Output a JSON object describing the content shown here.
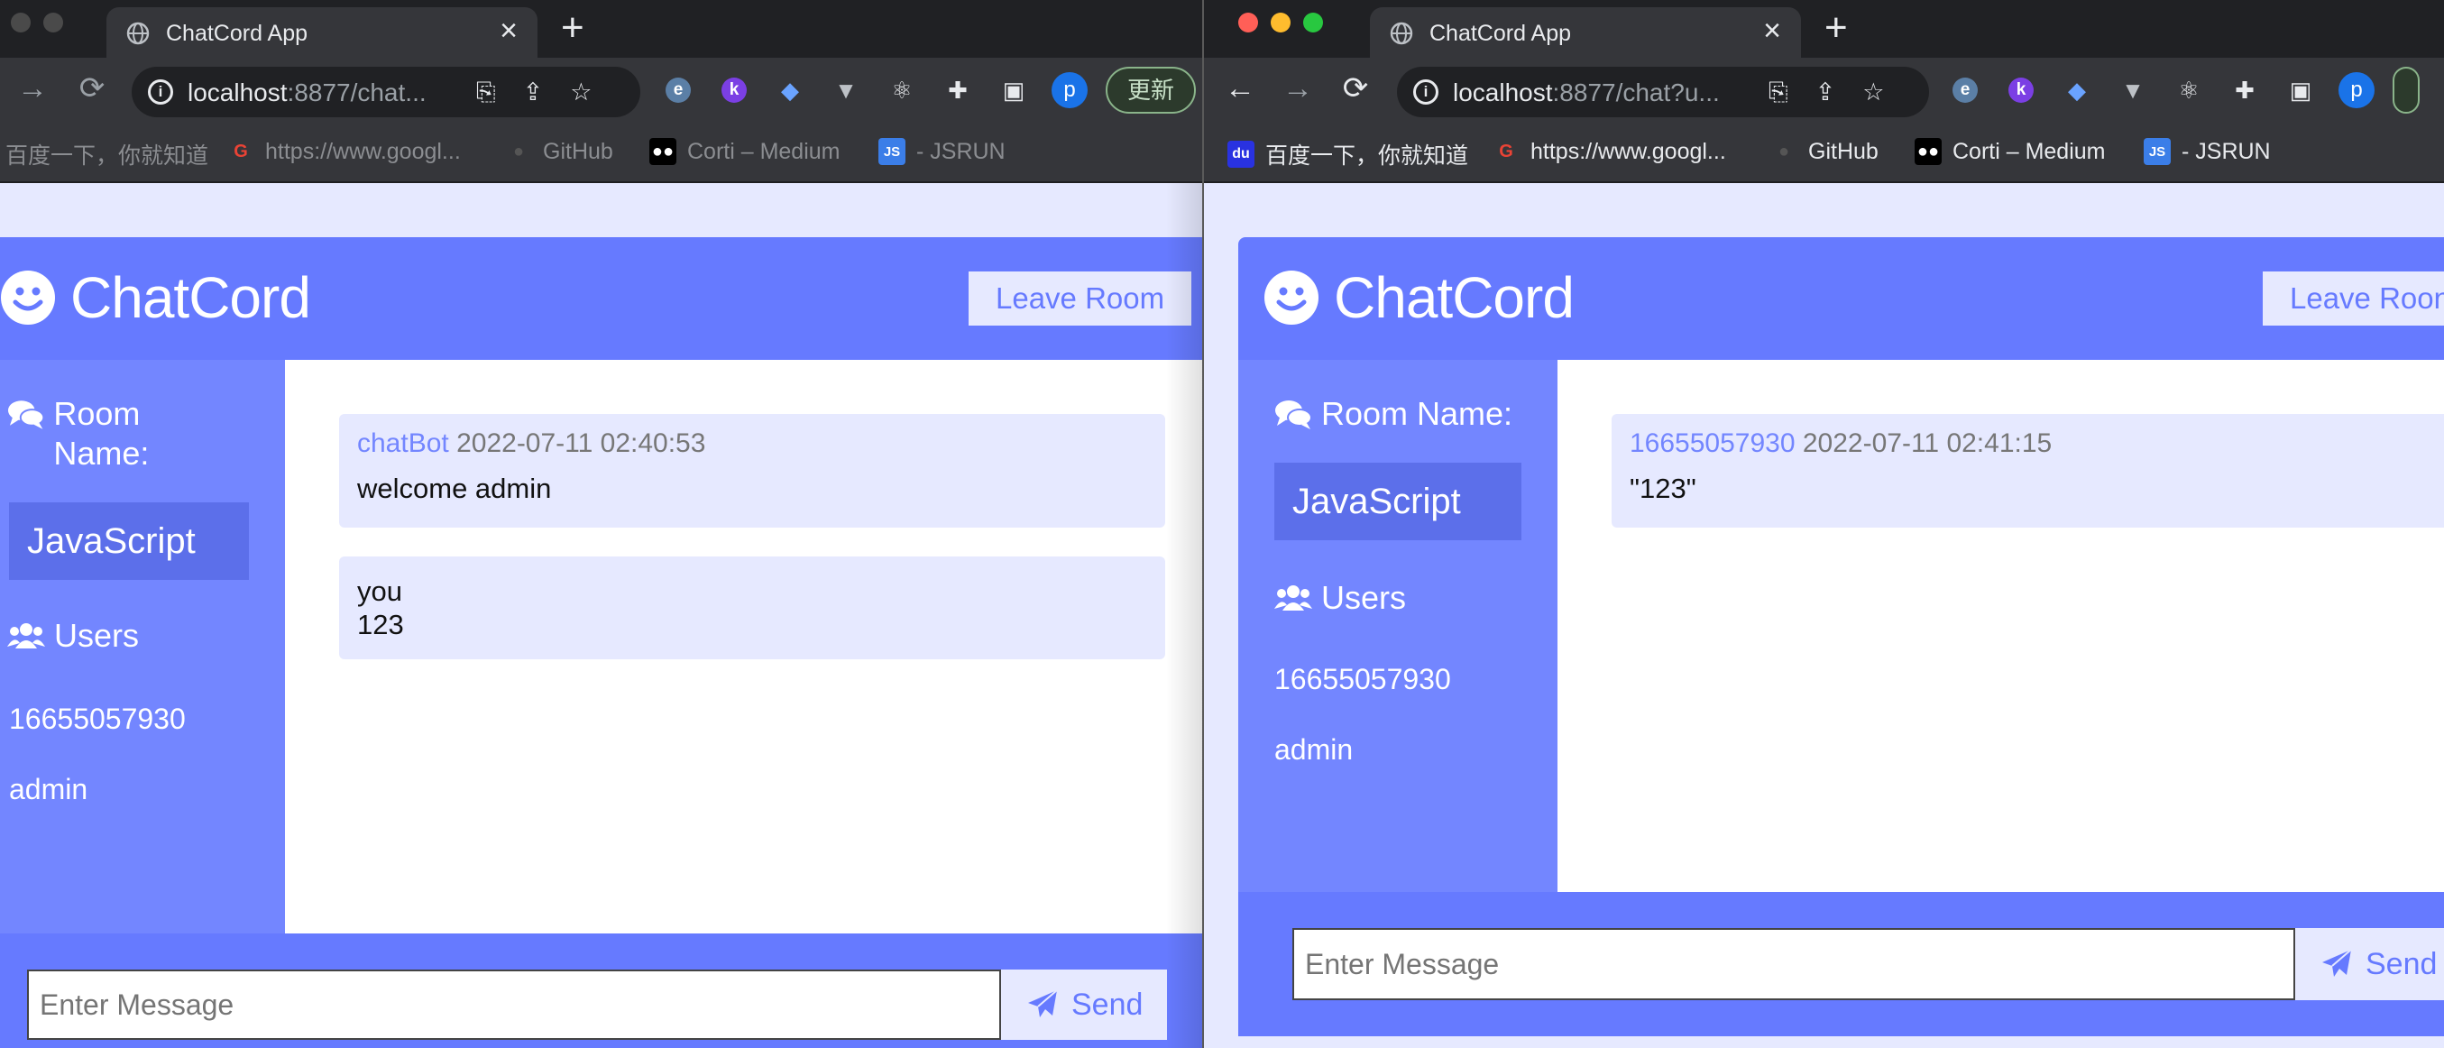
{
  "colors": {
    "brand": "#667aff",
    "sidebar": "#7386ff",
    "light": "#e6e9ff",
    "room_box": "#5c6fea"
  },
  "left": {
    "tab_title": "ChatCord App",
    "url_host": "localhost",
    "url_rest": ":8877/chat...",
    "update_label": "更新",
    "avatar_letter": "p",
    "bookmarks": [
      "百度一下，你就知道",
      "https://www.googl...",
      "GitHub",
      "Corti – Medium",
      "- JSRUN"
    ],
    "brand": "ChatCord",
    "leave_label": "Leave Room",
    "room_name_label": "Room Name:",
    "room_name": "JavaScript",
    "users_label": "Users",
    "users": [
      "16655057930",
      "admin"
    ],
    "messages": [
      {
        "user": "chatBot",
        "time": "2022-07-11 02:40:53",
        "text": "welcome admin"
      },
      {
        "user": "you",
        "time": "",
        "text": "123"
      }
    ],
    "input_placeholder": "Enter Message",
    "send_label": "Send"
  },
  "right": {
    "tab_title": "ChatCord App",
    "url_host": "localhost",
    "url_rest": ":8877/chat?u...",
    "avatar_letter": "p",
    "bookmarks": [
      "百度一下，你就知道",
      "https://www.googl...",
      "GitHub",
      "Corti – Medium",
      "- JSRUN"
    ],
    "brand": "ChatCord",
    "leave_label": "Leave Roon",
    "room_name_label": "Room Name:",
    "room_name": "JavaScript",
    "users_label": "Users",
    "users": [
      "16655057930",
      "admin"
    ],
    "messages": [
      {
        "user": "16655057930",
        "time": "2022-07-11 02:41:15",
        "text": "\"123\""
      }
    ],
    "input_placeholder": "Enter Message",
    "send_label": "Send"
  }
}
